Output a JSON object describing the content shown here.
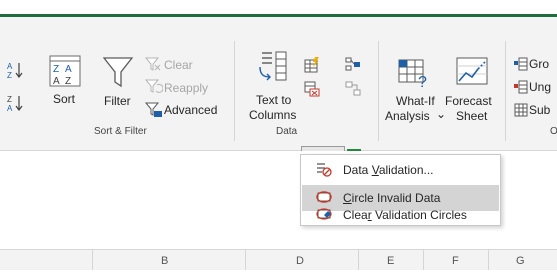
{
  "ribbon": {
    "sort_filter": {
      "sort_label": "Sort",
      "filter_label": "Filter",
      "clear_label": "Clear",
      "reapply_label": "Reapply",
      "advanced_label": "Advanced",
      "group_label": "Sort & Filter"
    },
    "data_tools": {
      "text_to_columns_line1": "Text to",
      "text_to_columns_line2": "Columns",
      "group_label_partial": "Data"
    },
    "forecast": {
      "whatif_line1": "What-If",
      "whatif_line2": "Analysis",
      "whatif_caret": "⌄",
      "forecast_line1": "Forecast",
      "forecast_line2": "Sheet"
    },
    "outline": {
      "group_partial": "Gro",
      "ungroup_partial": "Ung",
      "subtotal_partial": "Sub",
      "group_label_partial": "O"
    }
  },
  "dropdown": {
    "items": [
      {
        "label_pre": "Data ",
        "label_u": "V",
        "label_post": "alidation..."
      },
      {
        "label_pre": "",
        "label_u": "C",
        "label_post": "ircle Invalid Data"
      },
      {
        "label_pre": "Clea",
        "label_u": "r",
        "label_post": " Validation Circles"
      }
    ]
  },
  "columns": [
    "B",
    "D",
    "E",
    "F",
    "G"
  ],
  "colors": {
    "accent_green": "#1e6f3f",
    "ribbon_bg": "#f3f3f3",
    "highlight": "#d4d4d4"
  }
}
